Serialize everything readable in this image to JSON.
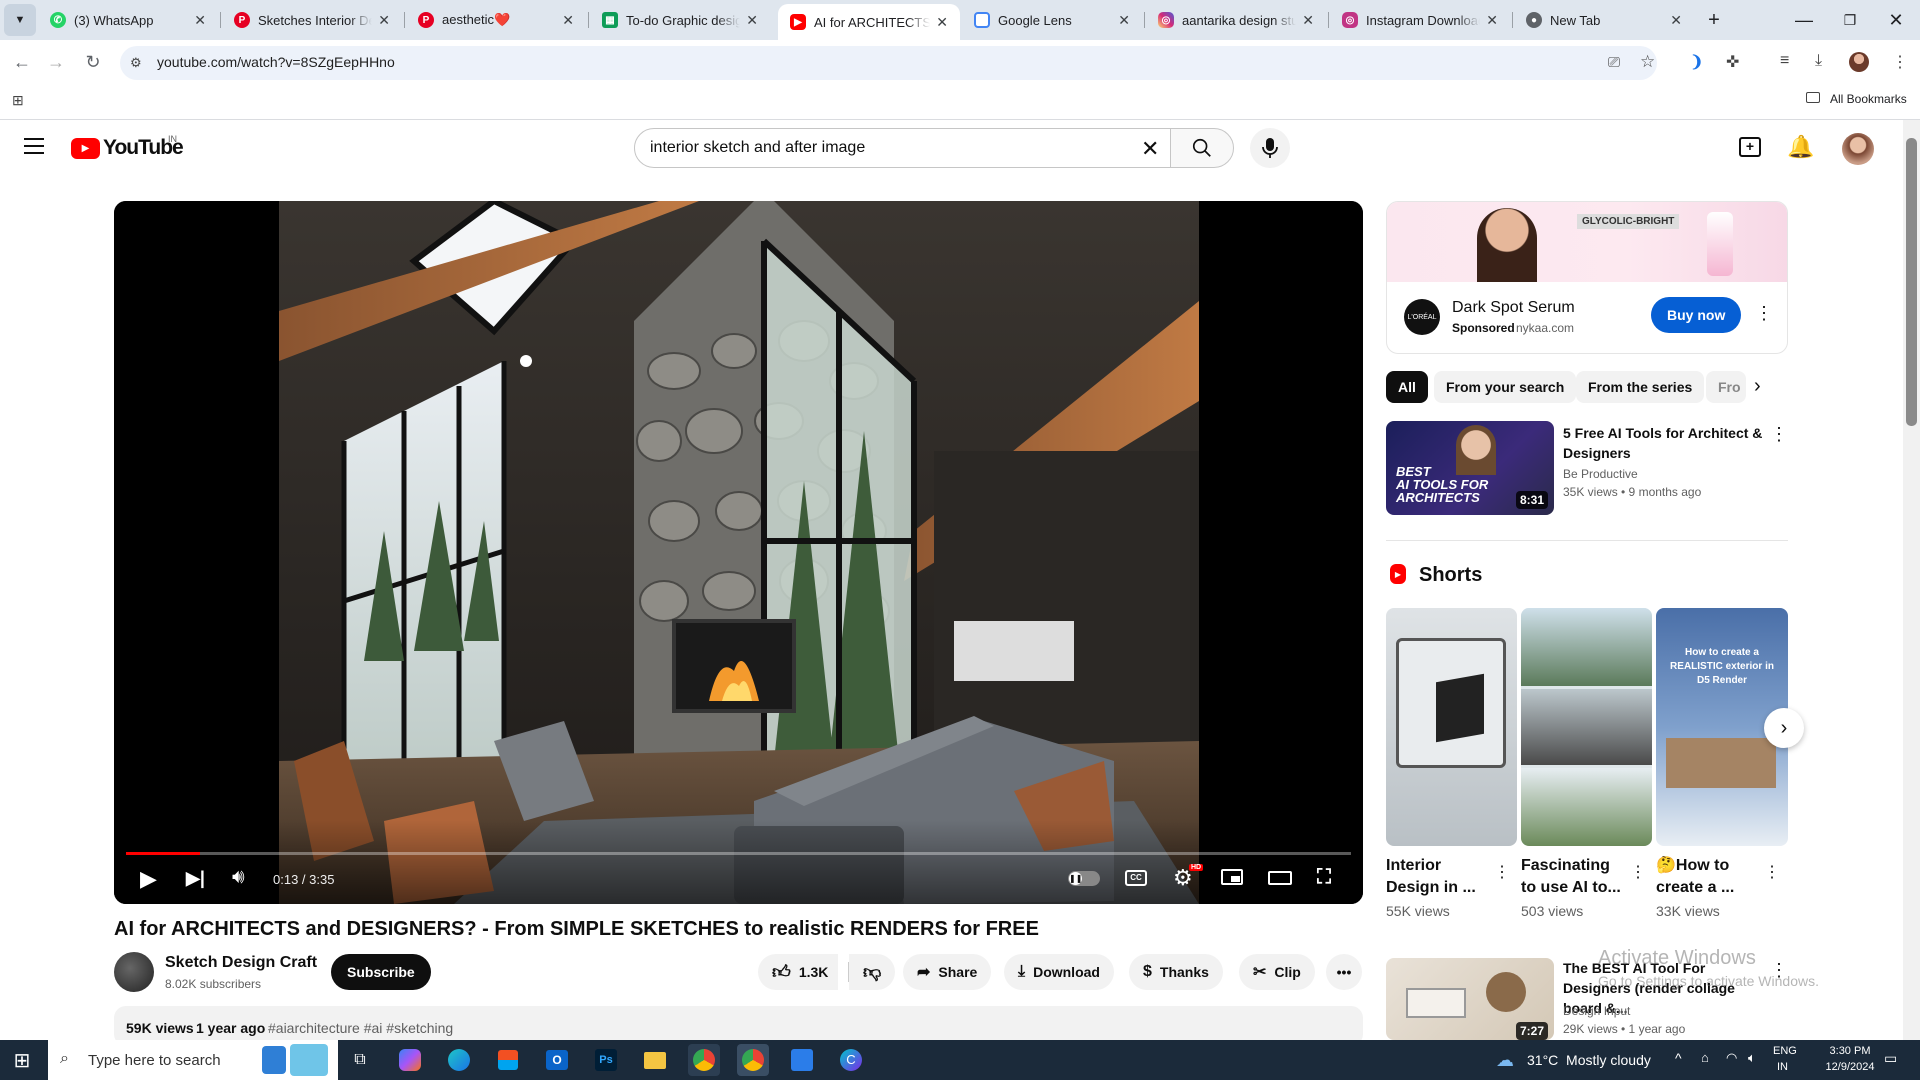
{
  "browser": {
    "tabs": [
      {
        "label": "(3) WhatsApp",
        "icon": "whatsapp-icon",
        "color": "#25d366"
      },
      {
        "label": "Sketches Interior Des",
        "icon": "pinterest-icon",
        "color": "#e60023"
      },
      {
        "label": "aesthetic❤️",
        "icon": "pinterest-icon",
        "color": "#e60023"
      },
      {
        "label": "To-do Graphic design",
        "icon": "sheets-icon",
        "color": "#0f9d58"
      },
      {
        "label": "AI for ARCHITECTS an",
        "icon": "youtube-icon",
        "color": "#ff0000"
      },
      {
        "label": "Google Lens",
        "icon": "google-lens-icon",
        "color": "#4285f4"
      },
      {
        "label": "aantarika design stud",
        "icon": "instagram-icon",
        "color": "#d62976"
      },
      {
        "label": "Instagram Download",
        "icon": "instagram-download-icon",
        "color": "#c13584"
      },
      {
        "label": "New Tab",
        "icon": "chrome-icon",
        "color": "#5f6368"
      }
    ],
    "url": "youtube.com/watch?v=8SZgEepHHno",
    "all_bookmarks": "All Bookmarks"
  },
  "youtube": {
    "logo": "YouTube",
    "region": "IN",
    "search_query": "interior sketch and after image",
    "video": {
      "title": "AI for ARCHITECTS and DESIGNERS? - From SIMPLE SKETCHES to realistic RENDERS for FREE",
      "time": "0:13 / 3:35",
      "progress": 0.06,
      "channel": "Sketch Design Craft",
      "subscribers": "8.02K subscribers",
      "subscribe": "Subscribe",
      "likes": "1.3K",
      "share": "Share",
      "download": "Download",
      "thanks": "Thanks",
      "clip": "Clip",
      "views": "59K views",
      "age": "1 year ago",
      "hashtags": "#aiarchitecture #ai #sketching",
      "hd_badge": "HD",
      "cc": "CC"
    },
    "ad": {
      "brand_text": "GLYCOLIC-BRIGHT",
      "title": "Dark Spot Serum",
      "sponsored": "Sponsored",
      "domain": "nykaa.com",
      "cta": "Buy now"
    },
    "chips": [
      "All",
      "From your search",
      "From the series",
      "Fro"
    ],
    "recommended": [
      {
        "title": "5 Free AI Tools for Architect & Designers",
        "channel": "Be Productive",
        "meta": "35K views • 9 months ago",
        "duration": "8:31"
      },
      {
        "title": "The BEST AI Tool For Designers (render collage board &...",
        "channel": "Design Input",
        "meta": "29K views • 1 year ago",
        "duration": "7:27"
      }
    ],
    "shorts_title": "Shorts",
    "shorts": [
      {
        "title": "Interior Design in ...",
        "views": "55K views"
      },
      {
        "title": "Fascinating to use AI to...",
        "views": "503 views"
      },
      {
        "title": "🤔How to create a ...",
        "views": "33K views"
      }
    ],
    "short_overlay_3": "How to create a REALISTIC exterior in D5 Render",
    "activate": {
      "line1": "Activate Windows",
      "line2": "Go to Settings to activate Windows."
    }
  },
  "taskbar": {
    "search_placeholder": "Type here to search",
    "weather": "31°C  Mostly cloudy",
    "lang1": "ENG",
    "lang2": "IN",
    "time": "3:30 PM",
    "date": "12/9/2024"
  }
}
